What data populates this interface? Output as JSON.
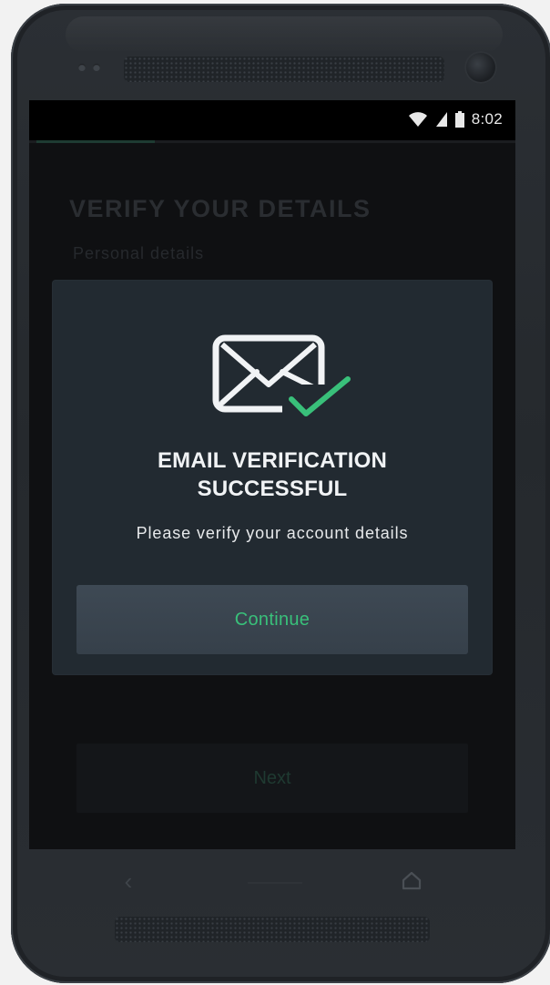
{
  "status_bar": {
    "time": "8:02",
    "icons": [
      "wifi-icon",
      "signal-icon",
      "battery-icon"
    ]
  },
  "wizard": {
    "progress": 0.25
  },
  "background_page": {
    "title": "VERIFY YOUR DETAILS",
    "subtitle": "Personal details",
    "next_label": "Next"
  },
  "modal": {
    "icon": "email-verified-icon",
    "title": "EMAIL VERIFICATION\nSUCCESSFUL",
    "message": "Please verify your account details",
    "continue_label": "Continue"
  },
  "nav_bar": {
    "back_icon": "back-arrow-icon",
    "home_icon": "home-icon"
  },
  "colors": {
    "accent": "#39c07a",
    "modal_background": "#222a31",
    "button_background": "#3a4550",
    "screen_background": "#0f1012"
  }
}
